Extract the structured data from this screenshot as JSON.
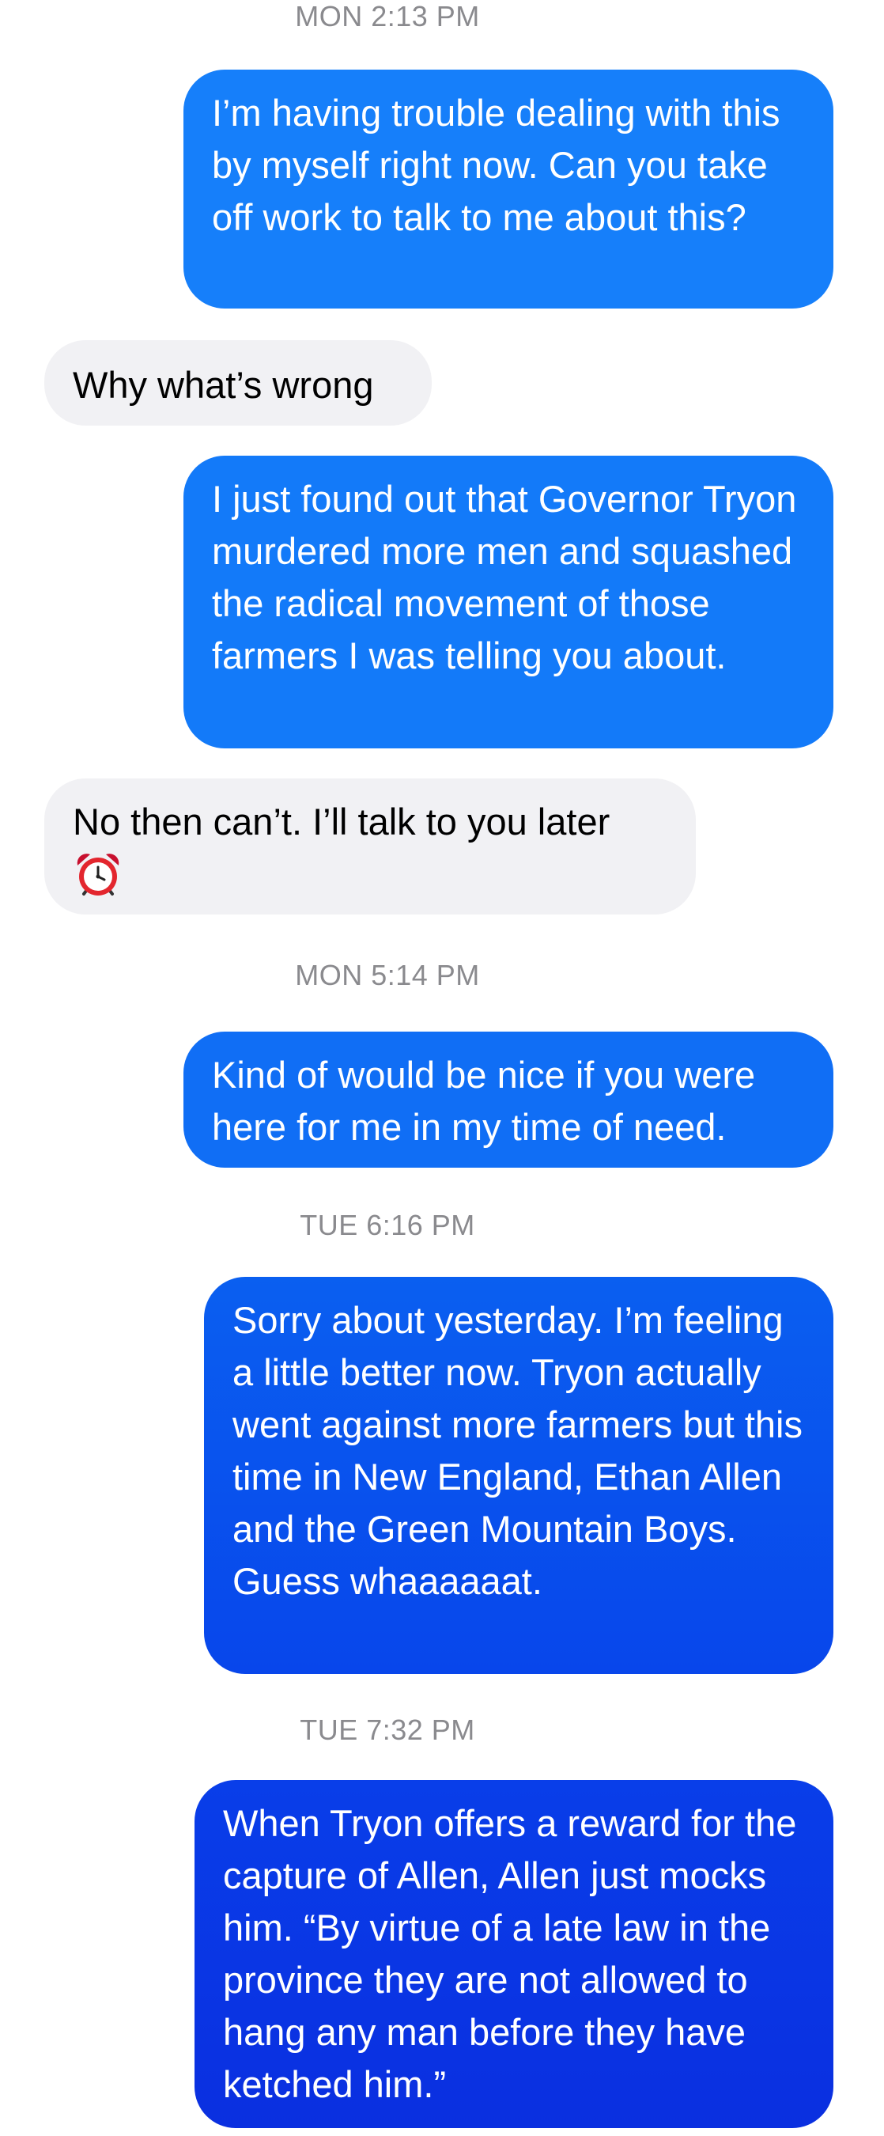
{
  "conversation": {
    "timestamps": {
      "t1": "MON 2:13 PM",
      "t2": "MON 5:14 PM",
      "t3": "TUE 6:16 PM",
      "t4": "TUE 7:32 PM"
    },
    "messages": {
      "m1": "I’m having trouble dealing with this by myself right now. Can you take off work to talk to me about this?",
      "m2": "Why what’s wrong",
      "m3": "I just found out that Governor Tryon murdered more men and squashed the radical movement of those farmers I was telling you about.",
      "m4": "No then can’t. I’ll talk to you later",
      "m5": "Kind of would be nice if you were here for me in my time of need.",
      "m6": "Sorry about yesterday. I’m feeling a little better now. Tryon actually went against more farmers but this time in New England, Ethan Allen and the Green Mountain Boys. Guess whaaaaaat.",
      "m7": "When Tryon offers a reward for the capture of Allen, Allen just mocks him. “By virtue of a late law in the province they are not allowed to hang any man before they have ketched him.”"
    },
    "emoji": {
      "m4": "alarm-clock-emoji"
    },
    "colors": {
      "sent_top": "#1782fb",
      "sent_bottom": "#0a2fe0",
      "received_bg": "#f1f1f4",
      "timestamp_text": "#8a8a8e"
    }
  }
}
